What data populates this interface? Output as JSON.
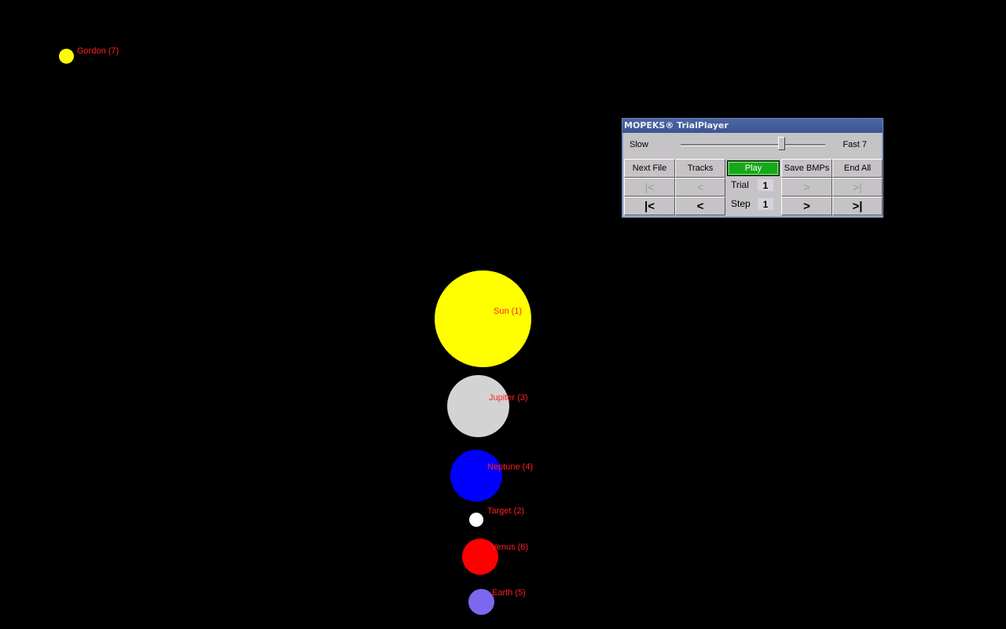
{
  "bodies": [
    {
      "label": "Gordon (7)",
      "color": "#ffff00"
    },
    {
      "label": "Sun (1)",
      "color": "#ffff00"
    },
    {
      "label": "Jupiter (3)",
      "color": "#d3d3d3"
    },
    {
      "label": "Neptune (4)",
      "color": "#0000ff"
    },
    {
      "label": "Target (2)",
      "color": "#ffffff"
    },
    {
      "label": "Venus (6)",
      "color": "#ff0000"
    },
    {
      "label": "Earth (5)",
      "color": "#7b68ee"
    }
  ],
  "player": {
    "title": "MOPEKS® TrialPlayer",
    "speed": {
      "slow_label": "Slow",
      "fast_label": "Fast 7",
      "level": 7
    },
    "buttons": {
      "next_file": "Next File",
      "tracks": "Tracks",
      "play": "Play",
      "save_bmps": "Save BMPs",
      "end_all": "End All"
    },
    "trial": {
      "label": "Trial",
      "value": "1"
    },
    "step": {
      "label": "Step",
      "value": "1"
    },
    "nav": {
      "first": "|<",
      "prev": "<",
      "next": ">",
      "last": ">|"
    },
    "play_color": "#16a816"
  }
}
